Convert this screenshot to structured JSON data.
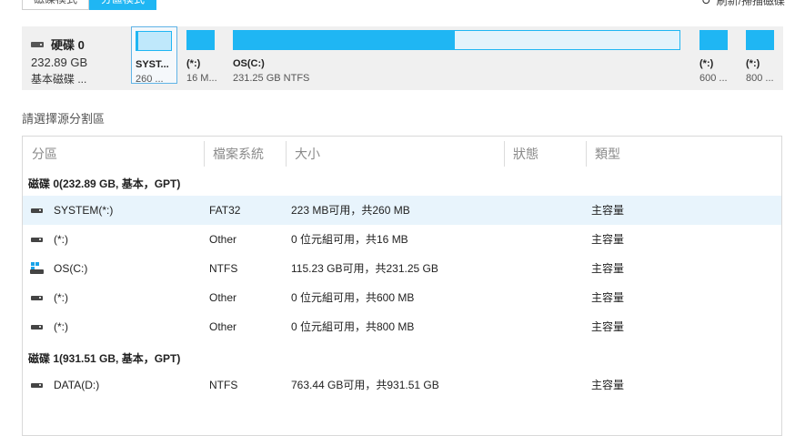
{
  "modes": {
    "tab1": "磁碟模式",
    "tab2": "分區模式"
  },
  "top_right": {
    "label": "刷新/掃描磁碟"
  },
  "disk0": {
    "title": "硬碟 0",
    "size": "232.89 GB",
    "type": "基本磁碟 ...",
    "partitions": [
      {
        "name": "SYST...",
        "desc": "260 ..."
      },
      {
        "name": "(*:)",
        "desc": "16 M..."
      },
      {
        "name": "OS(C:)",
        "desc": "231.25 GB NTFS"
      },
      {
        "name": "(*:)",
        "desc": "600 ..."
      },
      {
        "name": "(*:)",
        "desc": "800 ..."
      }
    ]
  },
  "section_label": "請選擇源分割區",
  "table": {
    "headers": [
      "分區",
      "檔案系統",
      "大小",
      "狀態",
      "類型"
    ],
    "groups": [
      {
        "label": "磁碟 0(232.89 GB, 基本，GPT)"
      },
      {
        "label": "磁碟 1(931.51 GB, 基本，GPT)"
      }
    ],
    "rows": [
      {
        "name": "SYSTEM(*:)",
        "fs": "FAT32",
        "size": "223 MB可用，共260 MB",
        "status": "",
        "type": "主容量"
      },
      {
        "name": "(*:)",
        "fs": "Other",
        "size": "0 位元組可用，共16 MB",
        "status": "",
        "type": "主容量"
      },
      {
        "name": "OS(C:)",
        "fs": "NTFS",
        "size": "115.23 GB可用，共231.25 GB",
        "status": "",
        "type": "主容量"
      },
      {
        "name": "(*:)",
        "fs": "Other",
        "size": "0 位元組可用，共600 MB",
        "status": "",
        "type": "主容量"
      },
      {
        "name": "(*:)",
        "fs": "Other",
        "size": "0 位元組可用，共800 MB",
        "status": "",
        "type": "主容量"
      },
      {
        "name": "DATA(D:)",
        "fs": "NTFS",
        "size": "763.44 GB可用，共931.51 GB",
        "status": "",
        "type": "主容量"
      }
    ]
  },
  "colors": {
    "accent": "#1fb6f3",
    "selected_row": "#e8f4fc",
    "panel": "#f0f0f0"
  }
}
